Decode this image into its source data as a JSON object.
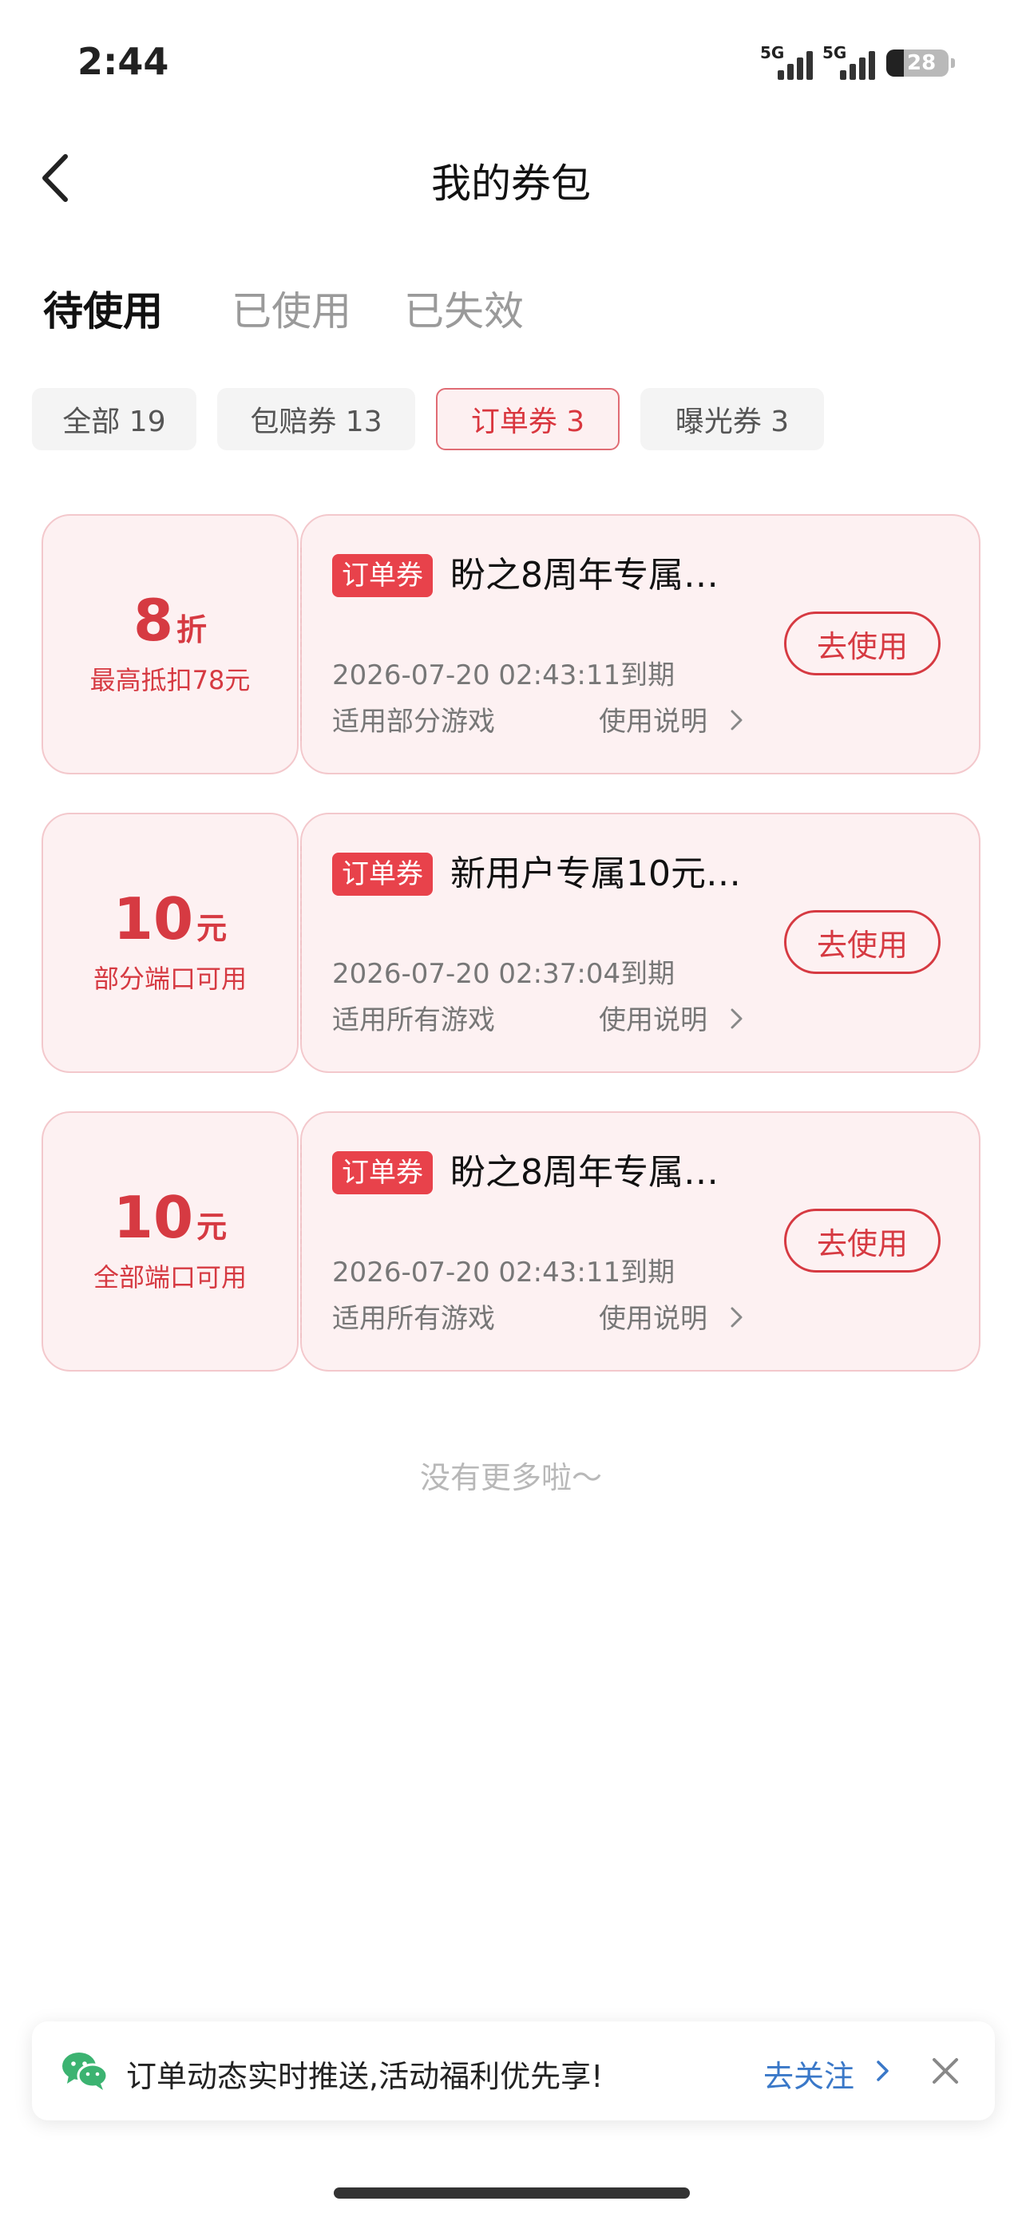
{
  "status_bar": {
    "time": "2:44",
    "network_1": "5G",
    "network_2": "5G",
    "battery": "28"
  },
  "header": {
    "title": "我的券包",
    "back_icon": "chevron-left-icon"
  },
  "status_tabs": [
    {
      "label": "待使用",
      "active": true
    },
    {
      "label": "已使用",
      "active": false
    },
    {
      "label": "已失效",
      "active": false
    }
  ],
  "filter_chips": [
    {
      "label": "全部 19",
      "active": false
    },
    {
      "label": "包赔券 13",
      "active": false
    },
    {
      "label": "订单券 3",
      "active": true
    },
    {
      "label": "曝光券 3",
      "active": false
    }
  ],
  "coupons": [
    {
      "value": "8",
      "unit": "折",
      "condition": "最高抵扣78元",
      "tag": "订单券",
      "title": "盼之8周年专属…",
      "expire": "2026-07-20 02:43:11到期",
      "scope": "适用部分游戏",
      "help": "使用说明",
      "use_button": "去使用"
    },
    {
      "value": "10",
      "unit": "元",
      "condition": "部分端口可用",
      "tag": "订单券",
      "title": "新用户专属10元…",
      "expire": "2026-07-20 02:37:04到期",
      "scope": "适用所有游戏",
      "help": "使用说明",
      "use_button": "去使用"
    },
    {
      "value": "10",
      "unit": "元",
      "condition": "全部端口可用",
      "tag": "订单券",
      "title": "盼之8周年专属…",
      "expire": "2026-07-20 02:43:11到期",
      "scope": "适用所有游戏",
      "help": "使用说明",
      "use_button": "去使用"
    }
  ],
  "list_end": "没有更多啦～",
  "follow_banner": {
    "icon": "wechat-icon",
    "text": "订单动态实时推送,活动福利优先享!",
    "link": "去关注",
    "close_icon": "close-icon"
  },
  "colors": {
    "accent": "#d63a42",
    "tag_bg": "#e8424b",
    "card_bg": "#fdf1f2",
    "link": "#3a78c8"
  }
}
